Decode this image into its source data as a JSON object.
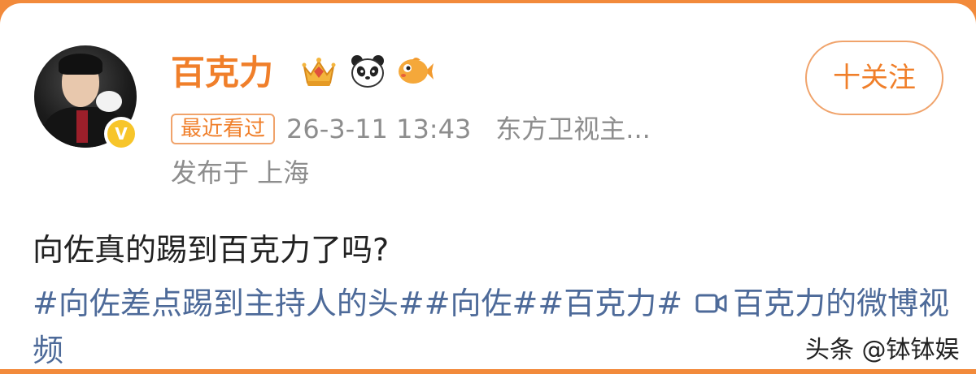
{
  "user": {
    "name": "百克力",
    "verified_badge": "V",
    "badges": [
      "crown-icon",
      "panda-icon",
      "fish-icon"
    ]
  },
  "follow_button": {
    "label": "十关注"
  },
  "meta": {
    "recent_tag": "最近看过",
    "time": "26-3-11 13:43",
    "source": "东方卫视主...",
    "location": "发布于 上海"
  },
  "post": {
    "text": "向佐真的踢到百克力了吗?",
    "hashtags": [
      "#向佐差点踢到主持人的头#",
      "#向佐#",
      "#百克力#"
    ],
    "video_link": "百克力的微博视频"
  },
  "watermark": "头条 @钵钵娱",
  "colors": {
    "accent": "#f07f2a",
    "link": "#4d6a99",
    "meta": "#8d8d8d",
    "top_strip": "#f28a3b"
  }
}
